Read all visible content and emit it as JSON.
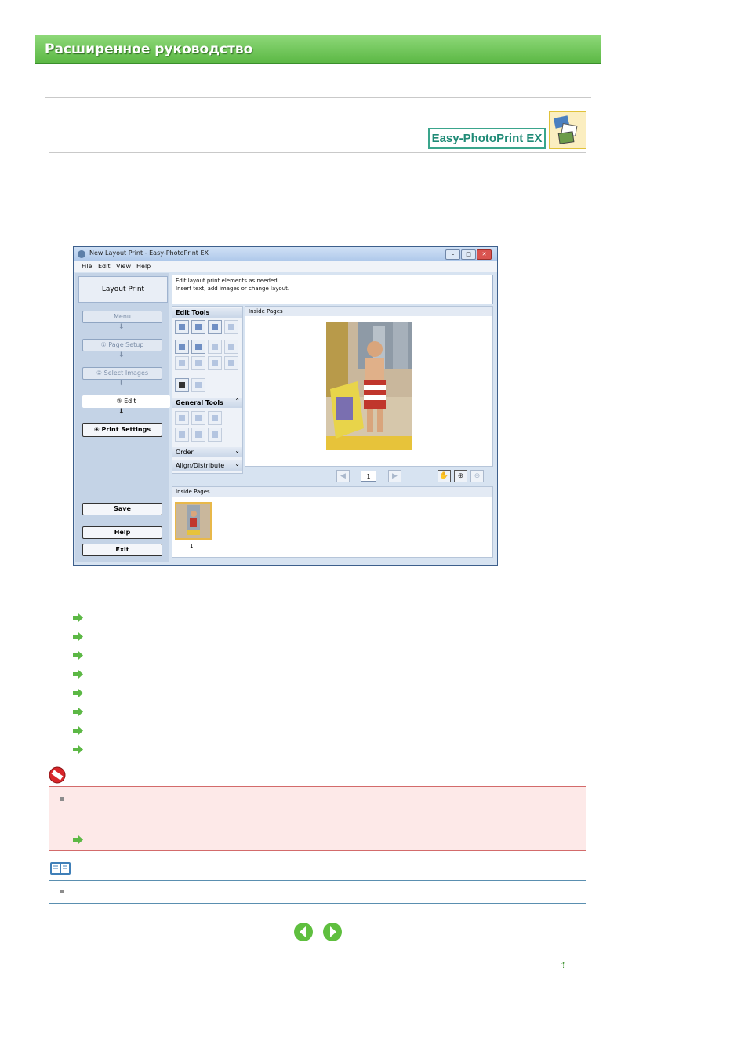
{
  "manual": {
    "banner_title": "Расширенное руководство",
    "product_logo": "Easy-PhotoPrint EX"
  },
  "app": {
    "window_title": "New Layout Print - Easy-PhotoPrint EX",
    "window_buttons": [
      "–",
      "□",
      "✕"
    ],
    "menu": [
      "File",
      "Edit",
      "View",
      "Help"
    ],
    "nav_title": "Layout Print",
    "nav": {
      "menu": "Menu",
      "page_setup": "① Page Setup",
      "select_images": "② Select Images",
      "edit": "③ Edit",
      "print_settings": "④ Print Settings",
      "save": "Save",
      "help": "Help",
      "exit": "Exit"
    },
    "hint_lines": [
      "Edit layout print elements as needed.",
      "Insert text, add images or change layout."
    ],
    "tools": {
      "edit_tools": "Edit Tools",
      "general_tools": "General Tools",
      "order": "Order",
      "align_distribute": "Align/Distribute"
    },
    "preview_header": "Inside Pages",
    "page_number": "1",
    "thumbs_header": "Inside Pages",
    "thumb_number": "1"
  },
  "icons": {
    "link_arrow": "right-arrow-icon",
    "important": "no-entry-icon",
    "note": "book-icon",
    "prev": "prev-page-icon",
    "next": "next-page-icon",
    "top": "page-top-icon"
  },
  "colors": {
    "banner": "#5cb845",
    "link_arrow": "#5cb845",
    "important_bg": "#fde9e8",
    "important_border": "#d36b6b",
    "note_rule": "#5a8fb0"
  }
}
